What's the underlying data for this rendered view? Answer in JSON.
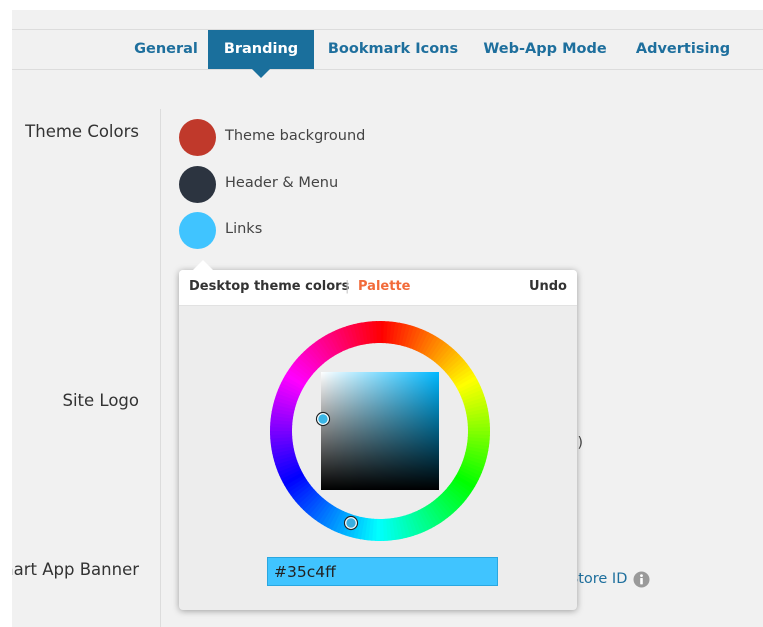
{
  "tabs": [
    {
      "label": "General",
      "active": false
    },
    {
      "label": "Branding",
      "active": true
    },
    {
      "label": "Bookmark Icons",
      "active": false
    },
    {
      "label": "Web-App Mode",
      "active": false
    },
    {
      "label": "Advertising",
      "active": false
    }
  ],
  "sections": {
    "theme_colors": "Theme Colors",
    "site_logo": "Site Logo",
    "smart_app_banner": "nart App Banner"
  },
  "theme_colors": [
    {
      "label": "Theme background",
      "color": "#c0392b"
    },
    {
      "label": "Header & Menu",
      "color": "#2c3440"
    },
    {
      "label": "Links",
      "color": "#40c4ff"
    }
  ],
  "background_fragments": {
    "site_logo_note": "ed)",
    "store_id": "Store ID"
  },
  "color_picker": {
    "title": "Desktop theme colors",
    "separator": "|",
    "palette_link": "Palette",
    "undo": "Undo",
    "hex_value": "#35c4ff",
    "accent_color": "#f26b3a"
  },
  "icons": [
    "info-icon",
    "color-wheel-hue-handle",
    "color-square-sv-handle"
  ]
}
